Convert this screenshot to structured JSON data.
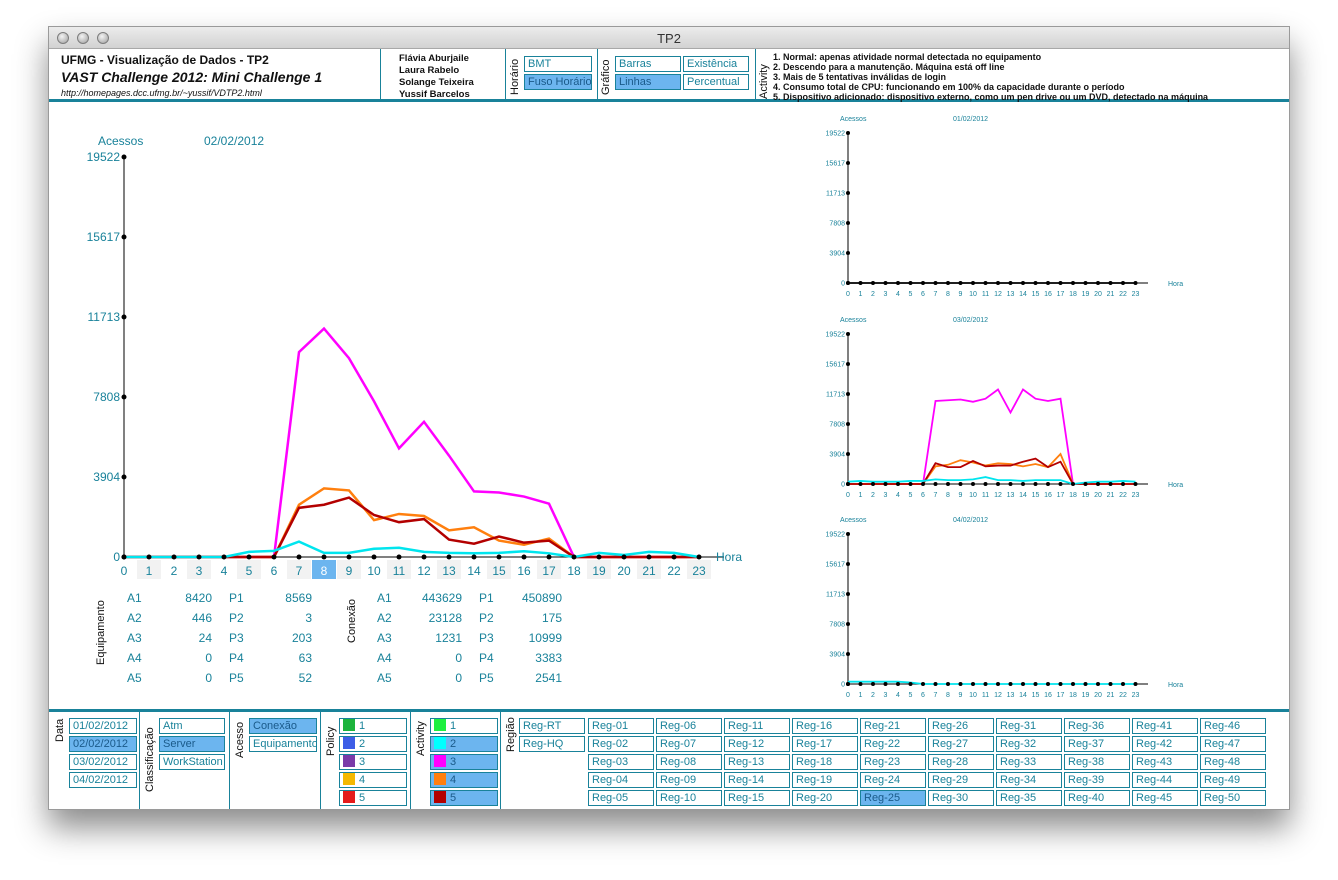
{
  "window": {
    "title": "TP2"
  },
  "header": {
    "title": "UFMG - Visualização de Dados - TP2",
    "subtitle": "VAST Challenge 2012: Mini Challenge 1",
    "url": "http://homepages.dcc.ufmg.br/~yussif/VDTP2.html",
    "authors": [
      "Flávia Aburjaile",
      "Laura Rabelo",
      "Solange Teixeira",
      "Yussif Barcelos"
    ],
    "horario": {
      "label": "Horário",
      "options": [
        {
          "label": "BMT",
          "selected": false
        },
        {
          "label": "Fuso Horário",
          "selected": true
        }
      ]
    },
    "grafico": {
      "label": "Gráfico",
      "options": [
        {
          "label": "Barras",
          "selected": false
        },
        {
          "label": "Existência",
          "selected": false
        },
        {
          "label": "Linhas",
          "selected": true
        },
        {
          "label": "Percentual",
          "selected": false
        }
      ]
    },
    "activity": {
      "label": "Activity",
      "lines": [
        "1. Normal: apenas atividade normal detectada no equipamento",
        "2. Descendo para a manutenção. Máquina está off line",
        "3. Mais de 5 tentativas inválidas de login",
        "4. Consumo total de CPU: funcionando em 100% da capacidade durante o período",
        "5. Dispositivo adicionado: dispositivo externo, como um pen drive ou um DVD, detectado na máquina"
      ]
    }
  },
  "main_chart": {
    "y_label": "Acessos",
    "date": "02/02/2012",
    "x_label": "Hora",
    "selected_hour": 8
  },
  "stats": {
    "equipamento": {
      "label": "Equipamento",
      "rows": [
        {
          "a": "A1",
          "av": "8420",
          "p": "P1",
          "pv": "8569"
        },
        {
          "a": "A2",
          "av": "446",
          "p": "P2",
          "pv": "3"
        },
        {
          "a": "A3",
          "av": "24",
          "p": "P3",
          "pv": "203"
        },
        {
          "a": "A4",
          "av": "0",
          "p": "P4",
          "pv": "63"
        },
        {
          "a": "A5",
          "av": "0",
          "p": "P5",
          "pv": "52"
        }
      ]
    },
    "conexao": {
      "label": "Conexão",
      "rows": [
        {
          "a": "A1",
          "av": "443629",
          "p": "P1",
          "pv": "450890"
        },
        {
          "a": "A2",
          "av": "23128",
          "p": "P2",
          "pv": "175"
        },
        {
          "a": "A3",
          "av": "1231",
          "p": "P3",
          "pv": "10999"
        },
        {
          "a": "A4",
          "av": "0",
          "p": "P4",
          "pv": "3383"
        },
        {
          "a": "A5",
          "av": "0",
          "p": "P5",
          "pv": "2541"
        }
      ]
    }
  },
  "chart_data": [
    {
      "type": "line",
      "title": "02/02/2012",
      "ylabel": "Acessos",
      "xlabel": "Hora",
      "ylim": [
        0,
        19522
      ],
      "y_ticks": [
        0,
        3904,
        7808,
        11713,
        15617,
        19522
      ],
      "x": [
        0,
        1,
        2,
        3,
        4,
        5,
        6,
        7,
        8,
        9,
        10,
        11,
        12,
        13,
        14,
        15,
        16,
        17,
        18,
        19,
        20,
        21,
        22,
        23
      ],
      "series": [
        {
          "color": "#ff00ff",
          "values": [
            0,
            0,
            0,
            0,
            0,
            0,
            0,
            10000,
            11150,
            9700,
            7600,
            5300,
            6600,
            4950,
            3200,
            3150,
            2950,
            2600,
            0,
            0,
            0,
            0,
            0,
            0
          ]
        },
        {
          "color": "#ff7f0e",
          "values": [
            0,
            0,
            0,
            0,
            0,
            0,
            0,
            2550,
            3350,
            3250,
            1800,
            2100,
            2000,
            1300,
            1450,
            800,
            600,
            900,
            0,
            0,
            0,
            0,
            0,
            0
          ]
        },
        {
          "color": "#b30000",
          "values": [
            0,
            0,
            0,
            0,
            0,
            0,
            0,
            2400,
            2550,
            2900,
            2050,
            1700,
            1850,
            850,
            650,
            1000,
            700,
            800,
            0,
            0,
            0,
            0,
            0,
            0
          ]
        },
        {
          "color": "#00e5ee",
          "values": [
            0,
            0,
            0,
            0,
            0,
            250,
            300,
            750,
            200,
            200,
            400,
            450,
            250,
            200,
            180,
            200,
            280,
            180,
            0,
            200,
            100,
            250,
            200,
            0
          ]
        }
      ]
    },
    {
      "type": "line",
      "title": "01/02/2012",
      "ylabel": "Acessos",
      "xlabel": "Hora",
      "ylim": [
        0,
        19522
      ],
      "y_ticks": [
        0,
        3904,
        7808,
        11713,
        15617,
        19522
      ],
      "x": [
        0,
        1,
        2,
        3,
        4,
        5,
        6,
        7,
        8,
        9,
        10,
        11,
        12,
        13,
        14,
        15,
        16,
        17,
        18,
        19,
        20,
        21,
        22,
        23
      ],
      "series": [
        {
          "color": "#000000",
          "values": [
            0,
            0,
            0,
            0,
            0,
            0,
            0,
            0,
            0,
            0,
            0,
            0,
            0,
            0,
            0,
            0,
            0,
            0,
            0,
            0,
            0,
            0,
            0,
            0
          ]
        }
      ]
    },
    {
      "type": "line",
      "title": "03/02/2012",
      "ylabel": "Acessos",
      "xlabel": "Hora",
      "ylim": [
        0,
        19522
      ],
      "y_ticks": [
        0,
        3904,
        7808,
        11713,
        15617,
        19522
      ],
      "x": [
        0,
        1,
        2,
        3,
        4,
        5,
        6,
        7,
        8,
        9,
        10,
        11,
        12,
        13,
        14,
        15,
        16,
        17,
        18,
        19,
        20,
        21,
        22,
        23
      ],
      "series": [
        {
          "color": "#ff00ff",
          "values": [
            0,
            0,
            0,
            0,
            0,
            0,
            0,
            10800,
            10900,
            11000,
            10700,
            11100,
            12300,
            9300,
            12300,
            11100,
            10800,
            11100,
            0,
            0,
            0,
            0,
            0,
            0
          ]
        },
        {
          "color": "#ff7f0e",
          "values": [
            0,
            0,
            0,
            0,
            0,
            0,
            0,
            2300,
            2500,
            3100,
            2800,
            2400,
            2700,
            2600,
            2300,
            2600,
            2200,
            3900,
            0,
            0,
            0,
            0,
            0,
            0
          ]
        },
        {
          "color": "#b30000",
          "values": [
            0,
            0,
            0,
            0,
            0,
            0,
            0,
            2700,
            2200,
            2200,
            3000,
            2300,
            2400,
            2400,
            2900,
            3300,
            2200,
            2900,
            0,
            0,
            0,
            0,
            0,
            0
          ]
        },
        {
          "color": "#00e5ee",
          "values": [
            300,
            400,
            300,
            300,
            300,
            400,
            400,
            600,
            500,
            500,
            600,
            900,
            500,
            500,
            400,
            500,
            500,
            500,
            0,
            200,
            300,
            300,
            400,
            300
          ]
        }
      ]
    },
    {
      "type": "line",
      "title": "04/02/2012",
      "ylabel": "Acessos",
      "xlabel": "Hora",
      "ylim": [
        0,
        19522
      ],
      "y_ticks": [
        0,
        3904,
        7808,
        11713,
        15617,
        19522
      ],
      "x": [
        0,
        1,
        2,
        3,
        4,
        5,
        6,
        7,
        8,
        9,
        10,
        11,
        12,
        13,
        14,
        15,
        16,
        17,
        18,
        19,
        20,
        21,
        22,
        23
      ],
      "series": [
        {
          "color": "#00e5ee",
          "values": [
            300,
            300,
            300,
            300,
            300,
            200,
            0,
            0,
            0,
            0,
            0,
            0,
            0,
            0,
            0,
            0,
            0,
            0,
            0,
            0,
            0,
            0,
            0,
            0
          ]
        }
      ]
    }
  ],
  "filters": {
    "data": {
      "label": "Data",
      "options": [
        {
          "label": "01/02/2012",
          "selected": false
        },
        {
          "label": "02/02/2012",
          "selected": true
        },
        {
          "label": "03/02/2012",
          "selected": false
        },
        {
          "label": "04/02/2012",
          "selected": false
        }
      ]
    },
    "classificacao": {
      "label": "Classificação",
      "options": [
        {
          "label": "Atm",
          "selected": false
        },
        {
          "label": "Server",
          "selected": true
        },
        {
          "label": "WorkStation",
          "selected": false
        }
      ]
    },
    "acesso": {
      "label": "Acesso",
      "options": [
        {
          "label": "Conexão",
          "selected": true
        },
        {
          "label": "Equipamento",
          "selected": false
        }
      ]
    },
    "policy": {
      "label": "Policy",
      "options": [
        {
          "label": "1",
          "color": "#1db33c",
          "selected": false
        },
        {
          "label": "2",
          "color": "#3e5de6",
          "selected": false
        },
        {
          "label": "3",
          "color": "#7b3aa8",
          "selected": false
        },
        {
          "label": "4",
          "color": "#f5b800",
          "selected": false
        },
        {
          "label": "5",
          "color": "#e51b1b",
          "selected": false
        }
      ]
    },
    "activity": {
      "label": "Activity",
      "options": [
        {
          "label": "1",
          "color": "#1ef040",
          "selected": false
        },
        {
          "label": "2",
          "color": "#00ffff",
          "selected": true
        },
        {
          "label": "3",
          "color": "#ff00ff",
          "selected": true
        },
        {
          "label": "4",
          "color": "#ff7f0e",
          "selected": true
        },
        {
          "label": "5",
          "color": "#b30000",
          "selected": true
        }
      ]
    },
    "regiao": {
      "label": "Região",
      "extra": [
        {
          "label": "Reg-RT",
          "selected": false
        },
        {
          "label": "Reg-HQ",
          "selected": false
        }
      ],
      "regions": [
        "Reg-01",
        "Reg-02",
        "Reg-03",
        "Reg-04",
        "Reg-05",
        "Reg-06",
        "Reg-07",
        "Reg-08",
        "Reg-09",
        "Reg-10",
        "Reg-11",
        "Reg-12",
        "Reg-13",
        "Reg-14",
        "Reg-15",
        "Reg-16",
        "Reg-17",
        "Reg-18",
        "Reg-19",
        "Reg-20",
        "Reg-21",
        "Reg-22",
        "Reg-23",
        "Reg-24",
        "Reg-25",
        "Reg-26",
        "Reg-27",
        "Reg-28",
        "Reg-29",
        "Reg-30",
        "Reg-31",
        "Reg-32",
        "Reg-33",
        "Reg-34",
        "Reg-35",
        "Reg-36",
        "Reg-37",
        "Reg-38",
        "Reg-39",
        "Reg-40",
        "Reg-41",
        "Reg-42",
        "Reg-43",
        "Reg-44",
        "Reg-45",
        "Reg-46",
        "Reg-47",
        "Reg-48",
        "Reg-49",
        "Reg-50"
      ],
      "selected": "Reg-25"
    }
  }
}
